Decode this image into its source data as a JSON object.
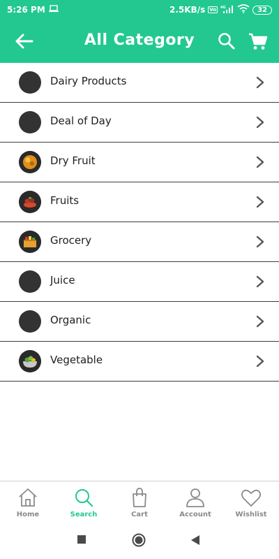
{
  "status_bar": {
    "time": "5:26 PM",
    "net_speed": "2.5KB/s",
    "volte": "Vo",
    "network": "4G",
    "battery": "32"
  },
  "app_bar": {
    "title": "All Category"
  },
  "categories": [
    {
      "label": "Dairy Products",
      "icon": "dairy-products-thumbnail"
    },
    {
      "label": "Deal of Day",
      "icon": "deal-of-day-thumbnail"
    },
    {
      "label": "Dry Fruit",
      "icon": "dry-fruit-thumbnail"
    },
    {
      "label": "Fruits",
      "icon": "fruits-thumbnail"
    },
    {
      "label": "Grocery",
      "icon": "grocery-thumbnail"
    },
    {
      "label": "Juice",
      "icon": "juice-thumbnail"
    },
    {
      "label": "Organic",
      "icon": "organic-thumbnail"
    },
    {
      "label": "Vegetable",
      "icon": "vegetable-thumbnail"
    }
  ],
  "bottom_nav": {
    "items": [
      {
        "label": "Home",
        "icon": "home-icon",
        "active": false
      },
      {
        "label": "Search",
        "icon": "search-icon",
        "active": true
      },
      {
        "label": "Cart",
        "icon": "shopping-bag-icon",
        "active": false
      },
      {
        "label": "Account",
        "icon": "person-icon",
        "active": false
      },
      {
        "label": "Wishlist",
        "icon": "heart-icon",
        "active": false
      }
    ]
  },
  "colors": {
    "primary": "#22c890",
    "active_tab": "#22c890",
    "inactive_tab": "#8a8a8a",
    "divider": "#3c3c3c",
    "thumbnail": "#333333"
  }
}
